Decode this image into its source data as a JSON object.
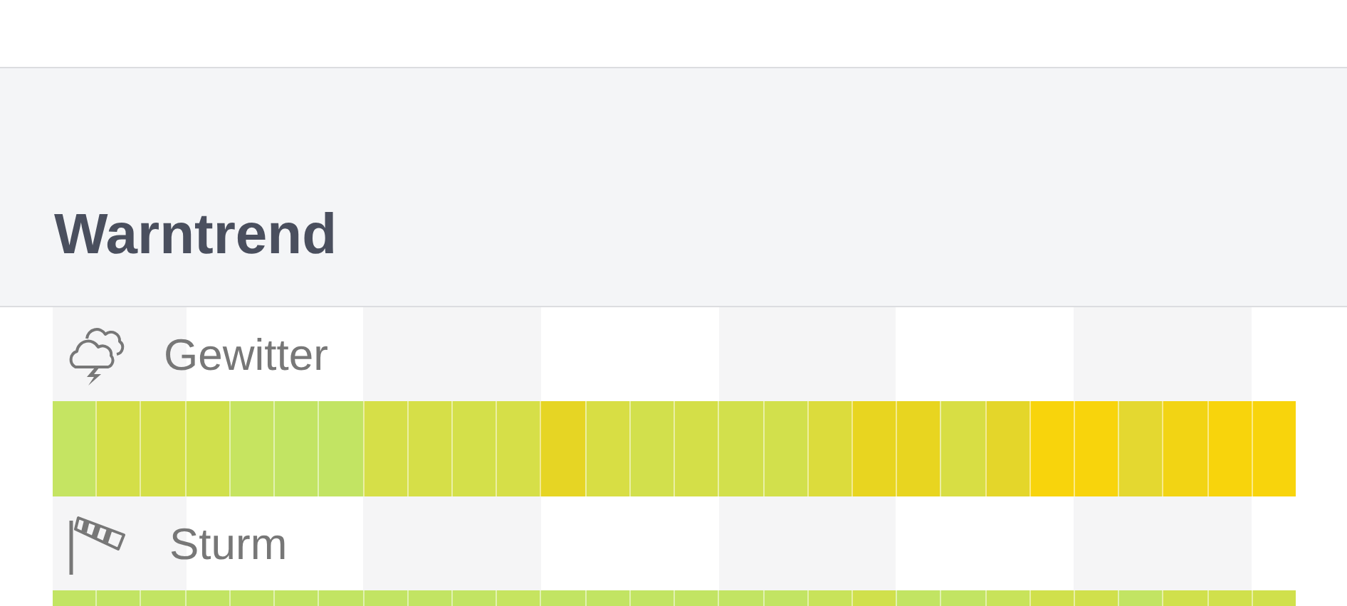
{
  "section": {
    "title": "Warntrend"
  },
  "rows": [
    {
      "kind": "thunderstorm",
      "label": "Gewitter",
      "segments": [
        {
          "color": "#c5e462"
        },
        {
          "color": "#d4df48"
        },
        {
          "color": "#d4df48"
        },
        {
          "color": "#d0e04c"
        },
        {
          "color": "#c6e460"
        },
        {
          "color": "#c2e463"
        },
        {
          "color": "#c2e463"
        },
        {
          "color": "#d6df48"
        },
        {
          "color": "#d6df48"
        },
        {
          "color": "#d4e04a"
        },
        {
          "color": "#d6df48"
        },
        {
          "color": "#e6d524"
        },
        {
          "color": "#d8de44"
        },
        {
          "color": "#d2e04c"
        },
        {
          "color": "#d4df48"
        },
        {
          "color": "#d2e04c"
        },
        {
          "color": "#d2e04c"
        },
        {
          "color": "#dcdc3c"
        },
        {
          "color": "#e8d520"
        },
        {
          "color": "#e8d520"
        },
        {
          "color": "#d8de44"
        },
        {
          "color": "#e4d62a"
        },
        {
          "color": "#f8d40c"
        },
        {
          "color": "#f8d40c"
        },
        {
          "color": "#e4d830"
        },
        {
          "color": "#f2d414"
        },
        {
          "color": "#f8d40c"
        },
        {
          "color": "#f8d40c"
        }
      ]
    },
    {
      "kind": "storm",
      "label": "Sturm",
      "segments": [
        {
          "color": "#c2e463"
        },
        {
          "color": "#c2e463"
        },
        {
          "color": "#c2e463"
        },
        {
          "color": "#c2e463"
        },
        {
          "color": "#c2e463"
        },
        {
          "color": "#c2e463"
        },
        {
          "color": "#c2e463"
        },
        {
          "color": "#c2e463"
        },
        {
          "color": "#c2e463"
        },
        {
          "color": "#c2e463"
        },
        {
          "color": "#c6e460"
        },
        {
          "color": "#c2e463"
        },
        {
          "color": "#c2e463"
        },
        {
          "color": "#c2e463"
        },
        {
          "color": "#c2e463"
        },
        {
          "color": "#c2e463"
        },
        {
          "color": "#c2e463"
        },
        {
          "color": "#c8e35a"
        },
        {
          "color": "#d0e04c"
        },
        {
          "color": "#c2e463"
        },
        {
          "color": "#c2e463"
        },
        {
          "color": "#c8e35a"
        },
        {
          "color": "#d0e04c"
        },
        {
          "color": "#d0e04c"
        },
        {
          "color": "#c2e463"
        },
        {
          "color": "#d0e04c"
        },
        {
          "color": "#d0e04c"
        },
        {
          "color": "#d0e04c"
        }
      ]
    }
  ]
}
